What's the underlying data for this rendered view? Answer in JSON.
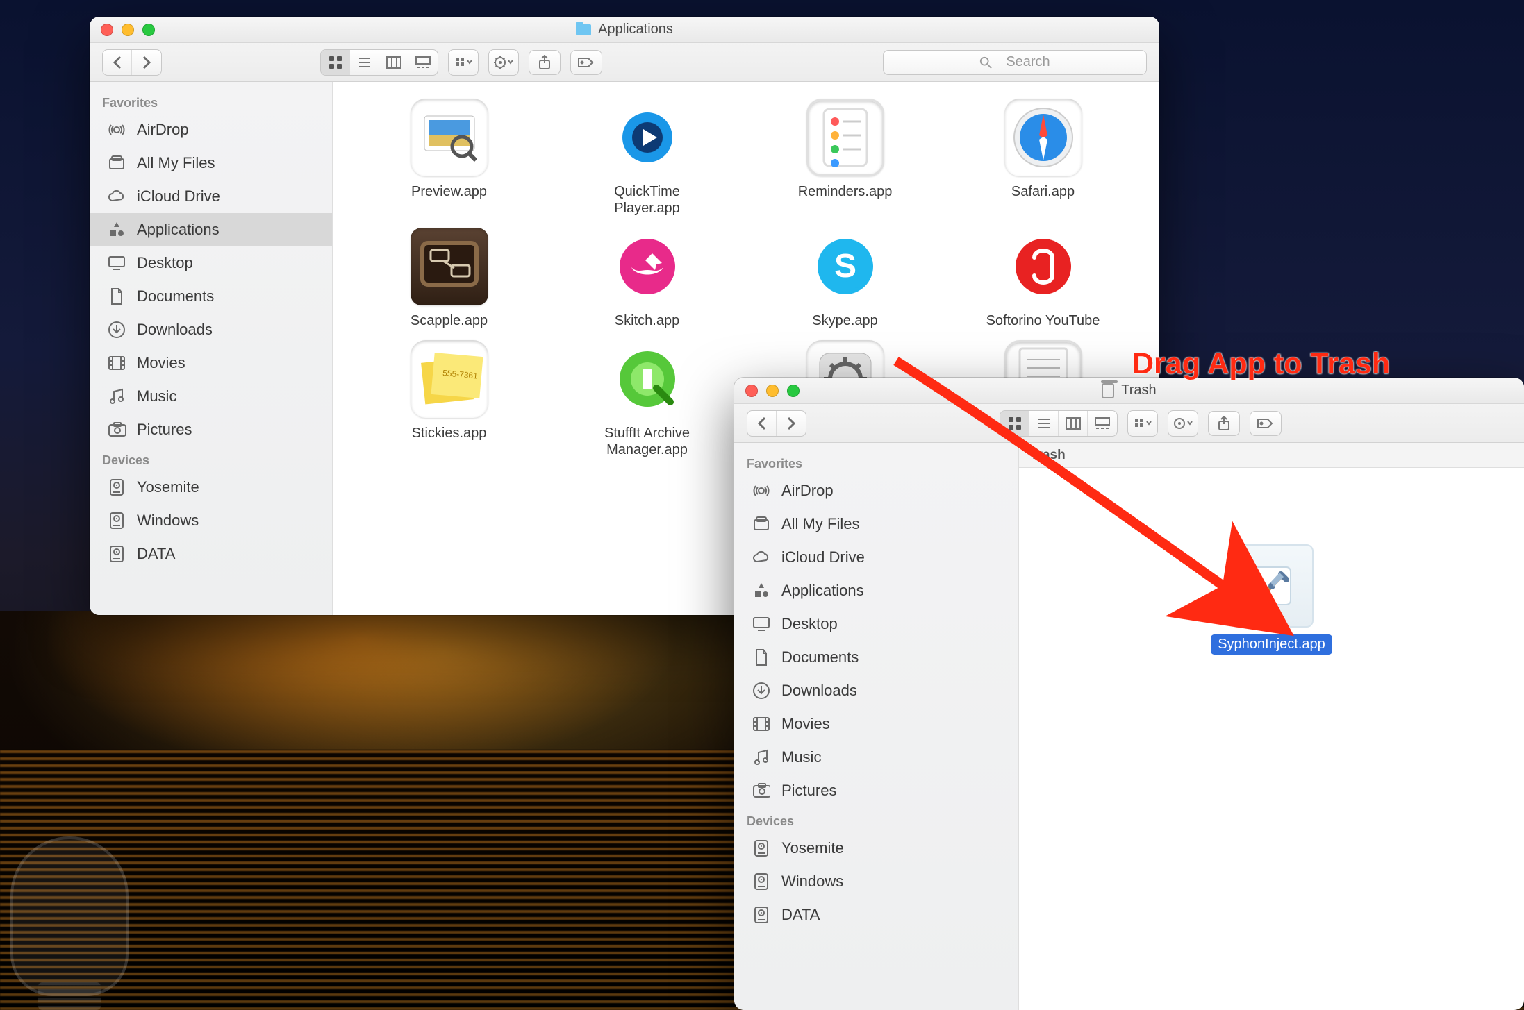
{
  "annotation": {
    "text": "Drag App to Trash",
    "color": "#ff2a12",
    "font_size": 43
  },
  "window_apps": {
    "title": "Applications",
    "search_placeholder": "Search",
    "sidebar": {
      "favorites_label": "Favorites",
      "devices_label": "Devices",
      "favorites": [
        {
          "label": "AirDrop",
          "icon": "airdrop"
        },
        {
          "label": "All My Files",
          "icon": "allfiles"
        },
        {
          "label": "iCloud Drive",
          "icon": "icloud"
        },
        {
          "label": "Applications",
          "icon": "apps",
          "selected": true
        },
        {
          "label": "Desktop",
          "icon": "desktop"
        },
        {
          "label": "Documents",
          "icon": "doc"
        },
        {
          "label": "Downloads",
          "icon": "download"
        },
        {
          "label": "Movies",
          "icon": "movie"
        },
        {
          "label": "Music",
          "icon": "music"
        },
        {
          "label": "Pictures",
          "icon": "pic"
        }
      ],
      "devices": [
        {
          "label": "Yosemite",
          "icon": "disk"
        },
        {
          "label": "Windows",
          "icon": "disk"
        },
        {
          "label": "DATA",
          "icon": "disk"
        }
      ]
    },
    "apps": [
      {
        "label": "Preview.app",
        "icon": "preview"
      },
      {
        "label": "QuickTime Player.app",
        "icon": "qt"
      },
      {
        "label": "Reminders.app",
        "icon": "rem"
      },
      {
        "label": "Safari.app",
        "icon": "safari"
      },
      {
        "label": "Scapple.app",
        "icon": "scapple"
      },
      {
        "label": "Skitch.app",
        "icon": "skitch"
      },
      {
        "label": "Skype.app",
        "icon": "skype"
      },
      {
        "label": "Softorino YouTube",
        "icon": "soft"
      },
      {
        "label": "Stickies.app",
        "icon": "stickies"
      },
      {
        "label": "StuffIt Archive Manager.app",
        "icon": "stuffit"
      },
      {
        "label": "",
        "icon": "sys"
      },
      {
        "label": "",
        "icon": "text"
      }
    ]
  },
  "window_trash": {
    "title": "Trash",
    "toolbar_header": "Trash",
    "sidebar": {
      "favorites_label": "Favorites",
      "devices_label": "Devices",
      "favorites": [
        {
          "label": "AirDrop",
          "icon": "airdrop"
        },
        {
          "label": "All My Files",
          "icon": "allfiles"
        },
        {
          "label": "iCloud Drive",
          "icon": "icloud"
        },
        {
          "label": "Applications",
          "icon": "apps"
        },
        {
          "label": "Desktop",
          "icon": "desktop"
        },
        {
          "label": "Documents",
          "icon": "doc"
        },
        {
          "label": "Downloads",
          "icon": "download"
        },
        {
          "label": "Movies",
          "icon": "movie"
        },
        {
          "label": "Music",
          "icon": "music"
        },
        {
          "label": "Pictures",
          "icon": "pic"
        }
      ],
      "devices": [
        {
          "label": "Yosemite",
          "icon": "disk"
        },
        {
          "label": "Windows",
          "icon": "disk"
        },
        {
          "label": "DATA",
          "icon": "disk"
        }
      ]
    },
    "item_label": "SyphonInject.app"
  }
}
